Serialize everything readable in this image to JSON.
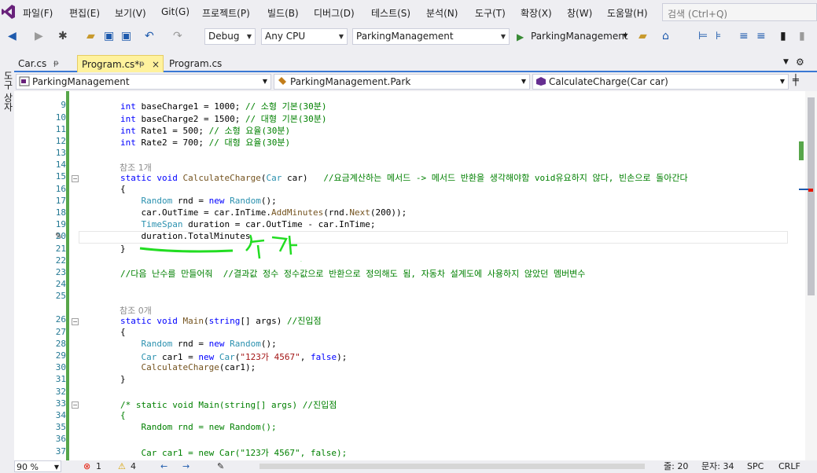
{
  "menu": [
    "파일(F)",
    "편집(E)",
    "보기(V)",
    "Git(G)",
    "프로젝트(P)",
    "빌드(B)",
    "디버그(D)",
    "테스트(S)",
    "분석(N)",
    "도구(T)",
    "확장(X)",
    "창(W)",
    "도움말(H)"
  ],
  "search_placeholder": "검색 (Ctrl+Q)",
  "toolbar": {
    "config": "Debug",
    "platform": "Any CPU",
    "startup_project": "ParkingManagement",
    "run_label": "ParkingManagement"
  },
  "tabs": [
    {
      "label": "Car.cs",
      "pin": "ᵽ"
    },
    {
      "label": "Program.cs*",
      "pin": "ᵽ",
      "close": "×"
    },
    {
      "label": "Program.cs"
    }
  ],
  "nav": {
    "project": "ParkingManagement",
    "class": "ParkingManagement.Park",
    "member": "CalculateCharge(Car car)"
  },
  "left_strip_label": "도구 상자",
  "editor": {
    "hint1": "참조 1개",
    "hint2": "참조 0개",
    "annotation": "추가",
    "line_numbers": [
      "9",
      "10",
      "11",
      "12",
      "13",
      "14",
      "15",
      "16",
      "17",
      "18",
      "19",
      "20",
      "21",
      "22",
      "23",
      "24",
      "25",
      "26",
      "27",
      "28",
      "29",
      "30",
      "31",
      "32",
      "33",
      "34",
      "35",
      "36",
      "37"
    ]
  },
  "status": {
    "zoom": "90 %",
    "errors": "1",
    "warnings": "4",
    "line": "줄: 20",
    "col": "문자: 34",
    "spc": "SPC",
    "crlf": "CRLF"
  },
  "colors": {
    "accent": "#3A78D4",
    "active_tab": "#FFF29D",
    "keyword": "#0000FF",
    "type": "#2B91AF",
    "comment": "#008000",
    "string": "#A31515"
  }
}
